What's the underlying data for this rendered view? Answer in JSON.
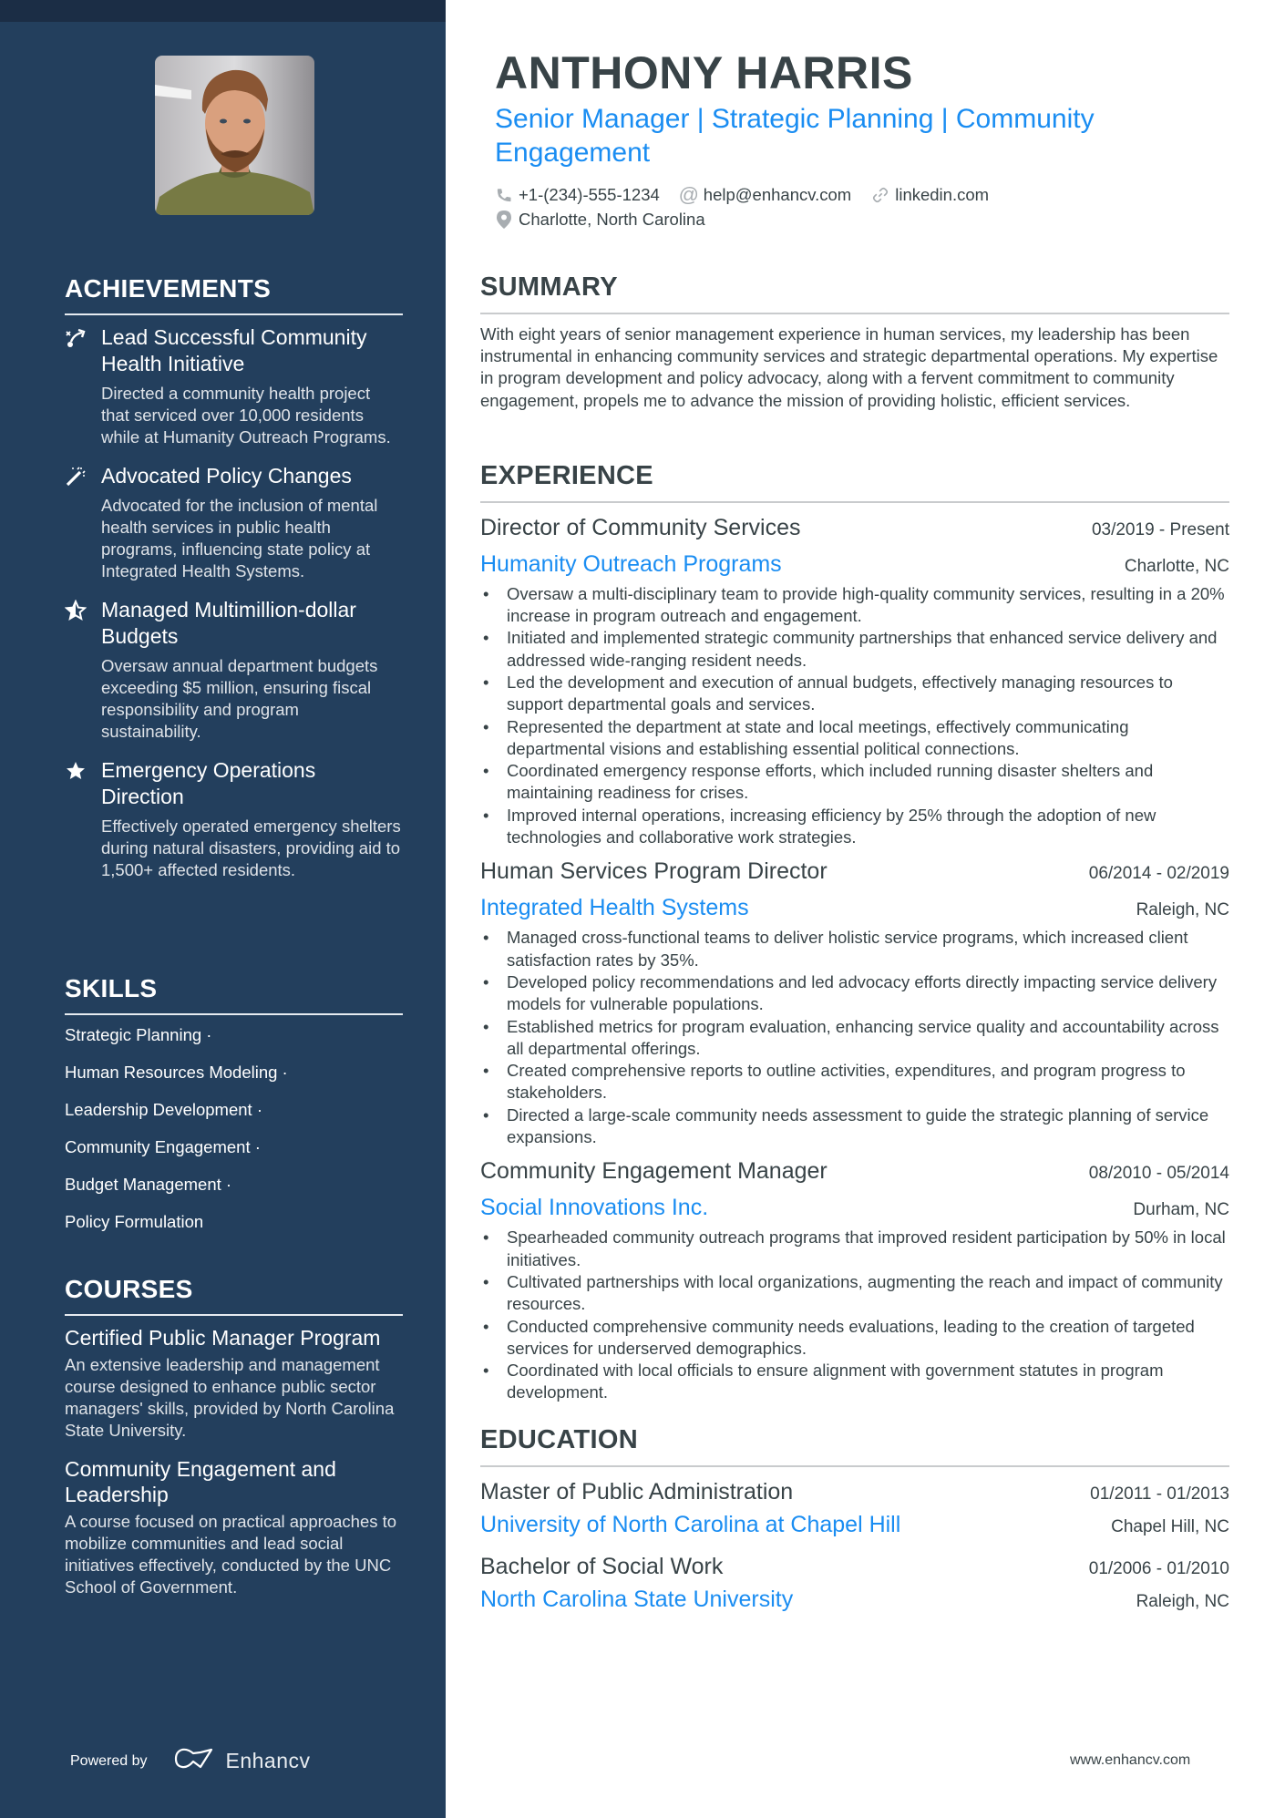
{
  "profile": {
    "name": "ANTHONY HARRIS",
    "headline": "Senior Manager | Strategic Planning | Community Engagement",
    "photo_alt": "Profile photo of Anthony Harris",
    "contacts": {
      "phone": "+1-(234)-555-1234",
      "email": "help@enhancv.com",
      "linkedin": "linkedin.com",
      "location": "Charlotte, North Carolina"
    }
  },
  "sidebar": {
    "achievements": {
      "heading": "ACHIEVEMENTS",
      "items": [
        {
          "icon": "trajectory-icon",
          "title": "Lead Successful Community Health Initiative",
          "description": "Directed a community health project that serviced over 10,000 residents while at Humanity Outreach Programs."
        },
        {
          "icon": "magic-wand-icon",
          "title": "Advocated Policy Changes",
          "description": "Advocated for the inclusion of mental health services in public health programs, influencing state policy at Integrated Health Systems."
        },
        {
          "icon": "star-half-icon",
          "title": "Managed Multimillion-dollar Budgets",
          "description": "Oversaw annual department budgets exceeding $5 million, ensuring fiscal responsibility and program sustainability."
        },
        {
          "icon": "star-icon",
          "title": "Emergency Operations Direction",
          "description": "Effectively operated emergency shelters during natural disasters, providing aid to 1,500+ affected residents."
        }
      ]
    },
    "skills": {
      "heading": "SKILLS",
      "items": [
        "Strategic Planning ·",
        "Human Resources Modeling ·",
        "Leadership Development ·",
        "Community Engagement ·",
        "Budget Management ·",
        "Policy Formulation"
      ]
    },
    "courses": {
      "heading": "COURSES",
      "items": [
        {
          "title": "Certified Public Manager Program",
          "description": "An extensive leadership and management course designed to enhance public sector managers' skills, provided by North Carolina State University."
        },
        {
          "title": "Community Engagement and Leadership",
          "description": "A course focused on practical approaches to mobilize communities and lead social initiatives effectively, conducted by the UNC School of Government."
        }
      ]
    },
    "powered_by": "Powered by",
    "brand": "Enhancv"
  },
  "summary": {
    "heading": "SUMMARY",
    "text": "With eight years of senior management experience in human services, my leadership has been instrumental in enhancing community services and strategic departmental operations. My expertise in program development and policy advocacy, along with a fervent commitment to community engagement, propels me to advance the mission of providing holistic, efficient services."
  },
  "experience": {
    "heading": "EXPERIENCE",
    "jobs": [
      {
        "title": "Director of Community Services",
        "dates": "03/2019 - Present",
        "company": "Humanity Outreach Programs",
        "location": "Charlotte, NC",
        "bullets": [
          "Oversaw a multi-disciplinary team to provide high-quality community services, resulting in a 20% increase in program outreach and engagement.",
          "Initiated and implemented strategic community partnerships that enhanced service delivery and addressed wide-ranging resident needs.",
          "Led the development and execution of annual budgets, effectively managing resources to support departmental goals and services.",
          "Represented the department at state and local meetings, effectively communicating departmental visions and establishing essential political connections.",
          "Coordinated emergency response efforts, which included running disaster shelters and maintaining readiness for crises.",
          "Improved internal operations, increasing efficiency by 25% through the adoption of new technologies and collaborative work strategies."
        ]
      },
      {
        "title": "Human Services Program Director",
        "dates": "06/2014 - 02/2019",
        "company": "Integrated Health Systems",
        "location": "Raleigh, NC",
        "bullets": [
          "Managed cross-functional teams to deliver holistic service programs, which increased client satisfaction rates by 35%.",
          "Developed policy recommendations and led advocacy efforts directly impacting service delivery models for vulnerable populations.",
          "Established metrics for program evaluation, enhancing service quality and accountability across all departmental offerings.",
          "Created comprehensive reports to outline activities, expenditures, and program progress to stakeholders.",
          "Directed a large-scale community needs assessment to guide the strategic planning of service expansions."
        ]
      },
      {
        "title": "Community Engagement Manager",
        "dates": "08/2010 - 05/2014",
        "company": "Social Innovations Inc.",
        "location": "Durham, NC",
        "bullets": [
          "Spearheaded community outreach programs that improved resident participation by 50% in local initiatives.",
          "Cultivated partnerships with local organizations, augmenting the reach and impact of community resources.",
          "Conducted comprehensive community needs evaluations, leading to the creation of targeted services for underserved demographics.",
          "Coordinated with local officials to ensure alignment with government statutes in program development."
        ]
      }
    ]
  },
  "education": {
    "heading": "EDUCATION",
    "items": [
      {
        "degree": "Master of Public Administration",
        "dates": "01/2011 - 01/2013",
        "school": "University of North Carolina at Chapel Hill",
        "location": "Chapel Hill, NC"
      },
      {
        "degree": "Bachelor of Social Work",
        "dates": "01/2006 - 01/2010",
        "school": "North Carolina State University",
        "location": "Raleigh, NC"
      }
    ]
  },
  "footer": {
    "url": "www.enhancv.com"
  },
  "colors": {
    "sidebar_bg": "#233f5d",
    "sidebar_topband": "#1b2d45",
    "accent": "#1a8df2",
    "text": "#384347"
  }
}
